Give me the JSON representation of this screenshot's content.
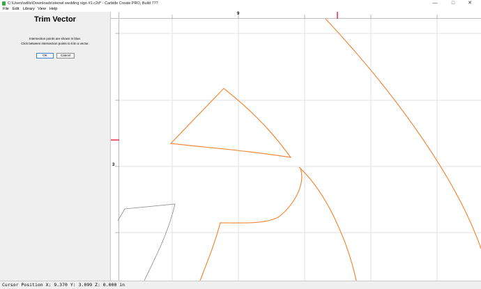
{
  "window": {
    "title": "C:\\Users\\willis\\Downloads\\stenwl wedding sign #1.c2d* - Carbide Create PRO, Build 777",
    "controls": {
      "minimize": "—",
      "maximize": "□",
      "close": "✕"
    }
  },
  "menu": [
    {
      "label": "File"
    },
    {
      "label": "Edit"
    },
    {
      "label": "Library"
    },
    {
      "label": "View"
    },
    {
      "label": "Help"
    }
  ],
  "panel": {
    "title": "Trim Vector",
    "line1": "Intersection points are shown in blue.",
    "line2": "Click between intersection points to trim a vector.",
    "ok_label": "OK",
    "cancel_label": "Cancel"
  },
  "rulers": {
    "top_label": "9",
    "left_label": "3"
  },
  "status": {
    "text": "Cursor Position X: 9.370 Y: 3.099 Z: 0.000 in"
  },
  "colors": {
    "vector": "#f08a3c",
    "selected_vector": "#8a8a8a",
    "ruler_marker": "#e0203a",
    "grid": "#e2e2e2"
  }
}
